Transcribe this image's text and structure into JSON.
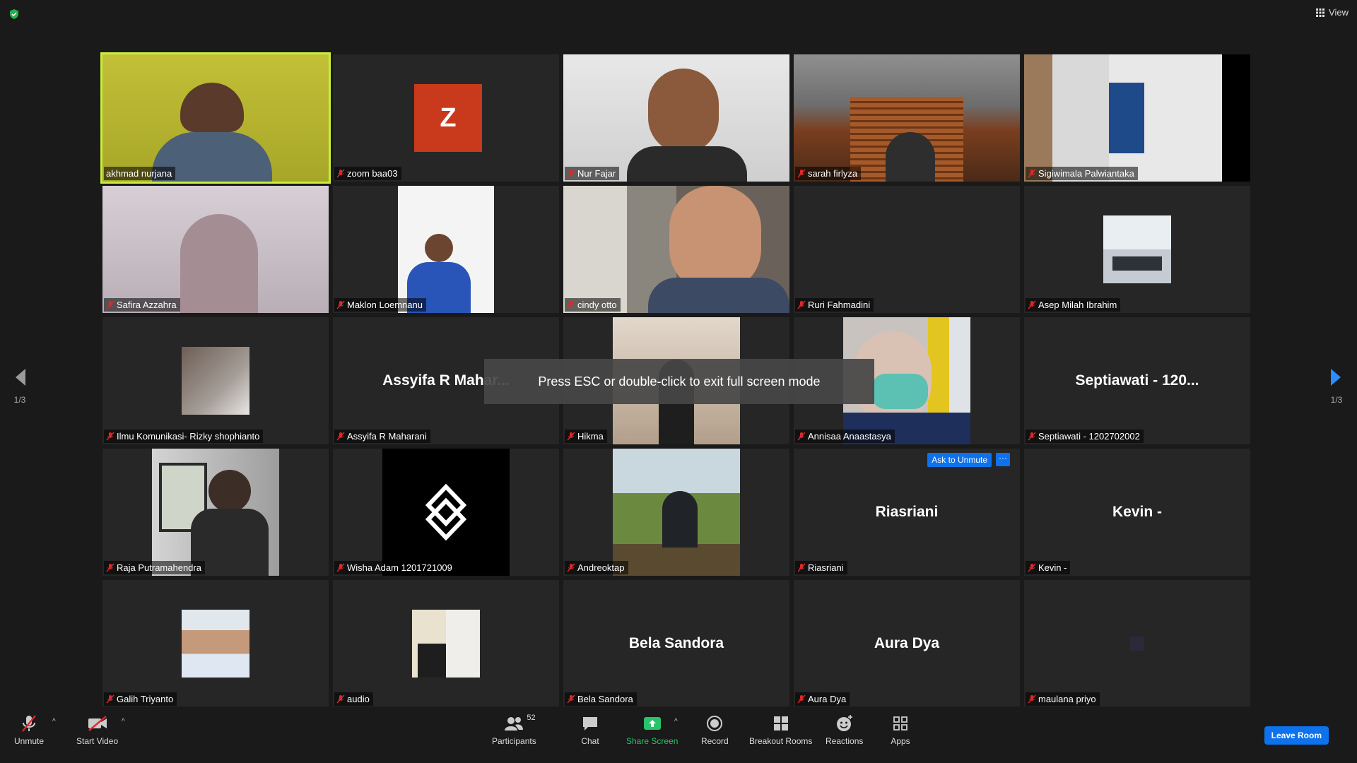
{
  "header": {
    "view_label": "View"
  },
  "participants": [
    {
      "name": "akhmad nurjana",
      "kind": "video",
      "active": true
    },
    {
      "name": "zoom baa03",
      "kind": "avatar",
      "initial": "Z",
      "avatar_color": "#c9391b"
    },
    {
      "name": "Nur Fajar",
      "kind": "video"
    },
    {
      "name": "sarah firlyza",
      "kind": "video"
    },
    {
      "name": "Sigiwimala Palwiantaka",
      "kind": "video"
    },
    {
      "name": "Safira Azzahra",
      "kind": "video"
    },
    {
      "name": "Maklon Loemnanu",
      "kind": "video"
    },
    {
      "name": "cindy otto",
      "kind": "video"
    },
    {
      "name": "Ruri Fahmadini",
      "kind": "blank"
    },
    {
      "name": "Asep Milah Ibrahim",
      "kind": "photo"
    },
    {
      "name": "Ilmu Komunikasi- Rizky shophianto",
      "kind": "photo"
    },
    {
      "name": "Assyifa R Maharani",
      "kind": "text",
      "display": "Assyifa R Mahar..."
    },
    {
      "name": "Hikma",
      "kind": "video"
    },
    {
      "name": "Annisaa Anaastasya",
      "kind": "video"
    },
    {
      "name": "Septiawati - 1202702002",
      "kind": "text",
      "display": "Septiawati - 120..."
    },
    {
      "name": "Raja Putramahendra",
      "kind": "video"
    },
    {
      "name": "Wisha Adam 1201721009",
      "kind": "logo"
    },
    {
      "name": "Andreoktap",
      "kind": "video"
    },
    {
      "name": "Riasriani",
      "kind": "text",
      "display": "Riasriani",
      "ask_unmute": "Ask to Unmute",
      "more": "···"
    },
    {
      "name": "Kevin -",
      "kind": "text",
      "display": "Kevin -"
    },
    {
      "name": "Galih Triyanto",
      "kind": "photo"
    },
    {
      "name": "audio",
      "kind": "photo"
    },
    {
      "name": "Bela Sandora",
      "kind": "text",
      "display": "Bela Sandora"
    },
    {
      "name": "Aura Dya",
      "kind": "text",
      "display": "Aura Dya"
    },
    {
      "name": "maulana priyo",
      "kind": "blank"
    }
  ],
  "pagination": {
    "left": "1/3",
    "right": "1/3"
  },
  "fullscreen_notice": "Press ESC or double-click to exit full screen mode",
  "toolbar": {
    "unmute": "Unmute",
    "start_video": "Start Video",
    "participants": "Participants",
    "participants_count": "52",
    "chat": "Chat",
    "share_screen": "Share Screen",
    "record": "Record",
    "breakout_rooms": "Breakout Rooms",
    "reactions": "Reactions",
    "apps": "Apps",
    "leave": "Leave Room"
  },
  "colors": {
    "accent": "#0e72ed",
    "share_green": "#28c36a",
    "active_speaker": "#c8ee3c",
    "muted_red": "#e02828"
  }
}
